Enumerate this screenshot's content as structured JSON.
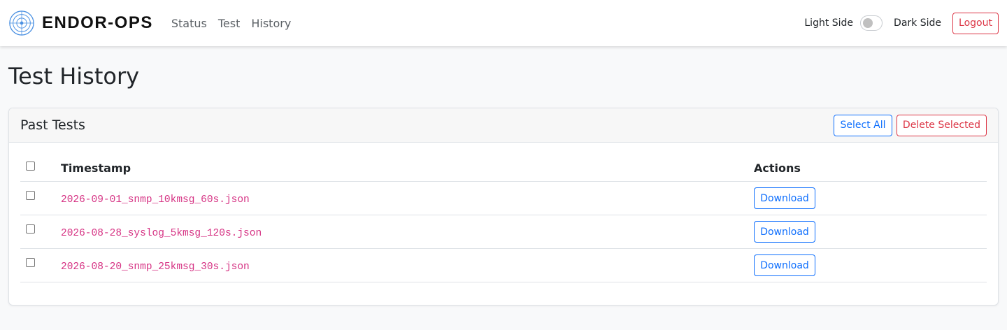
{
  "navbar": {
    "brand": "ENDOR-OPS",
    "links": [
      {
        "label": "Status"
      },
      {
        "label": "Test"
      },
      {
        "label": "History"
      }
    ],
    "theme": {
      "light_label": "Light Side",
      "dark_label": "Dark Side",
      "dark_enabled": false
    },
    "logout_label": "Logout"
  },
  "page": {
    "title": "Test History"
  },
  "card": {
    "title": "Past Tests",
    "select_all_label": "Select All",
    "delete_selected_label": "Delete Selected",
    "table": {
      "columns": [
        "Timestamp",
        "Actions"
      ],
      "rows": [
        {
          "file": "2026-09-01_snmp_10kmsg_60s.json",
          "action": "Download",
          "checked": false
        },
        {
          "file": "2026-08-28_syslog_5kmsg_120s.json",
          "action": "Download",
          "checked": false
        },
        {
          "file": "2026-08-20_snmp_25kmsg_30s.json",
          "action": "Download",
          "checked": false
        }
      ]
    }
  },
  "colors": {
    "primary": "#0d6efd",
    "danger": "#dc3545",
    "code": "#d63384",
    "logo": "#4a90e2"
  }
}
